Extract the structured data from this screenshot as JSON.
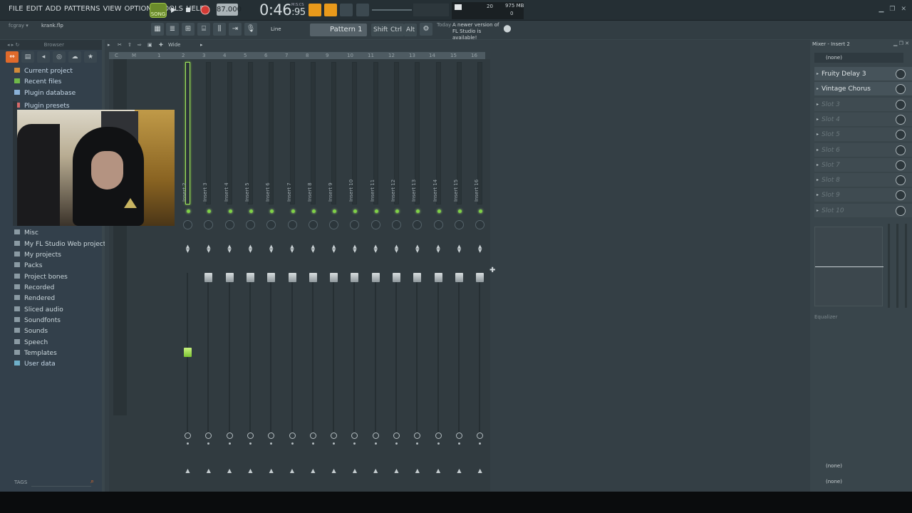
{
  "menu": [
    "FILE",
    "EDIT",
    "ADD",
    "PATTERNS",
    "VIEW",
    "OPTIONS",
    "TOOLS",
    "HELP"
  ],
  "transport": {
    "mode_label": "SONG",
    "tempo": "87.000",
    "time_main": "0:46",
    "time_fraction": ":95",
    "time_unit": "M:S:CS",
    "monitor_a": "20",
    "monitor_mem": "975 MB",
    "monitor_b": "0"
  },
  "hint": {
    "user": "fcgray ▾",
    "file": "krank.flp"
  },
  "toolbar2": {
    "snap": "Line",
    "pattern": "Pattern 1",
    "keys": [
      "Shift",
      "Ctrl",
      "Alt"
    ],
    "news_date": "Today",
    "news_line1": "A newer version of",
    "news_line2": "FL Studio is available!"
  },
  "browser": {
    "title": "Browser",
    "items": [
      {
        "label": "Current project",
        "type": "special"
      },
      {
        "label": "Recent files",
        "type": "special"
      },
      {
        "label": "Plugin database",
        "type": "special"
      },
      {
        "label": "Plugin presets",
        "type": "special"
      },
      {
        "label": "Misc",
        "type": "folder"
      },
      {
        "label": "My FL Studio Web projects",
        "type": "folder"
      },
      {
        "label": "My projects",
        "type": "folder"
      },
      {
        "label": "Packs",
        "type": "folder"
      },
      {
        "label": "Project bones",
        "type": "folder"
      },
      {
        "label": "Recorded",
        "type": "folder"
      },
      {
        "label": "Rendered",
        "type": "folder"
      },
      {
        "label": "Sliced audio",
        "type": "folder"
      },
      {
        "label": "Soundfonts",
        "type": "folder"
      },
      {
        "label": "Sounds",
        "type": "folder"
      },
      {
        "label": "Speech",
        "type": "folder"
      },
      {
        "label": "Templates",
        "type": "folder"
      },
      {
        "label": "User data",
        "type": "special"
      }
    ],
    "tags_label": "TAGS"
  },
  "mixer": {
    "view_label": "Wide",
    "strip_numbers": [
      "C",
      "M",
      "1",
      "2",
      "3",
      "4",
      "5",
      "6",
      "7",
      "8",
      "9",
      "10",
      "11",
      "12",
      "13",
      "14",
      "15",
      "16"
    ],
    "strips": [
      {
        "label": "Insert 2",
        "selected": true
      },
      {
        "label": "Insert 3"
      },
      {
        "label": "Insert 4"
      },
      {
        "label": "Insert 5"
      },
      {
        "label": "Insert 6"
      },
      {
        "label": "Insert 7"
      },
      {
        "label": "Insert 8"
      },
      {
        "label": "Insert 9"
      },
      {
        "label": "Insert 10"
      },
      {
        "label": "Insert 11"
      },
      {
        "label": "Insert 12"
      },
      {
        "label": "Insert 13"
      },
      {
        "label": "Insert 14"
      },
      {
        "label": "Insert 15"
      },
      {
        "label": "Insert 16"
      }
    ]
  },
  "insert_panel": {
    "title": "Mixer - Insert 2",
    "input": "(none)",
    "slots": [
      {
        "label": "Fruity Delay 3",
        "filled": true
      },
      {
        "label": "Vintage Chorus",
        "filled": true
      },
      {
        "label": "Slot 3",
        "filled": false
      },
      {
        "label": "Slot 4",
        "filled": false
      },
      {
        "label": "Slot 5",
        "filled": false
      },
      {
        "label": "Slot 6",
        "filled": false
      },
      {
        "label": "Slot 7",
        "filled": false
      },
      {
        "label": "Slot 8",
        "filled": false
      },
      {
        "label": "Slot 9",
        "filled": false
      },
      {
        "label": "Slot 10",
        "filled": false
      }
    ],
    "eq_label": "Equalizer",
    "output_1": "(none)",
    "output_2": "(none)"
  },
  "colors": {
    "accent_green": "#9fe25e",
    "accent_orange": "#e99a1b",
    "record_red": "#e03b3b",
    "browser_highlight": "#e06a2b"
  }
}
